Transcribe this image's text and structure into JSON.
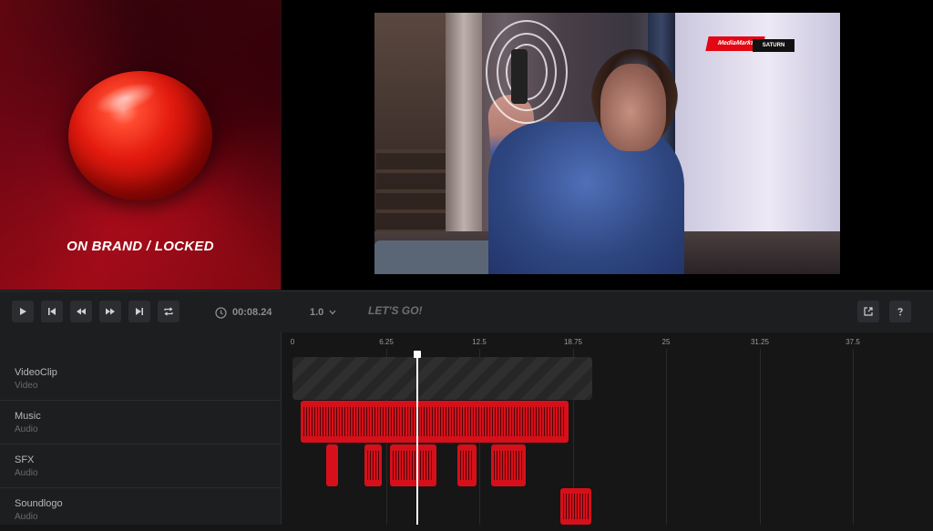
{
  "brand_panel": {
    "caption": "ON BRAND / LOCKED"
  },
  "preview": {
    "logo": {
      "mm": "MediaMarkt",
      "saturn": "SATURN"
    }
  },
  "toolbar": {
    "timecode": "00:08.24",
    "speed": "1.0",
    "cta": "LET'S GO!"
  },
  "timeline": {
    "ruler": [
      "0",
      "6.25",
      "12.5",
      "18.75",
      "25",
      "31.25",
      "37.5"
    ],
    "tracks": [
      {
        "name": "VideoClip",
        "type": "Video"
      },
      {
        "name": "Music",
        "type": "Audio"
      },
      {
        "name": "SFX",
        "type": "Audio"
      },
      {
        "name": "Soundlogo",
        "type": "Audio"
      }
    ]
  },
  "colors": {
    "accent": "#d5101a",
    "background": "#161616",
    "panel": "#1d1e20"
  }
}
